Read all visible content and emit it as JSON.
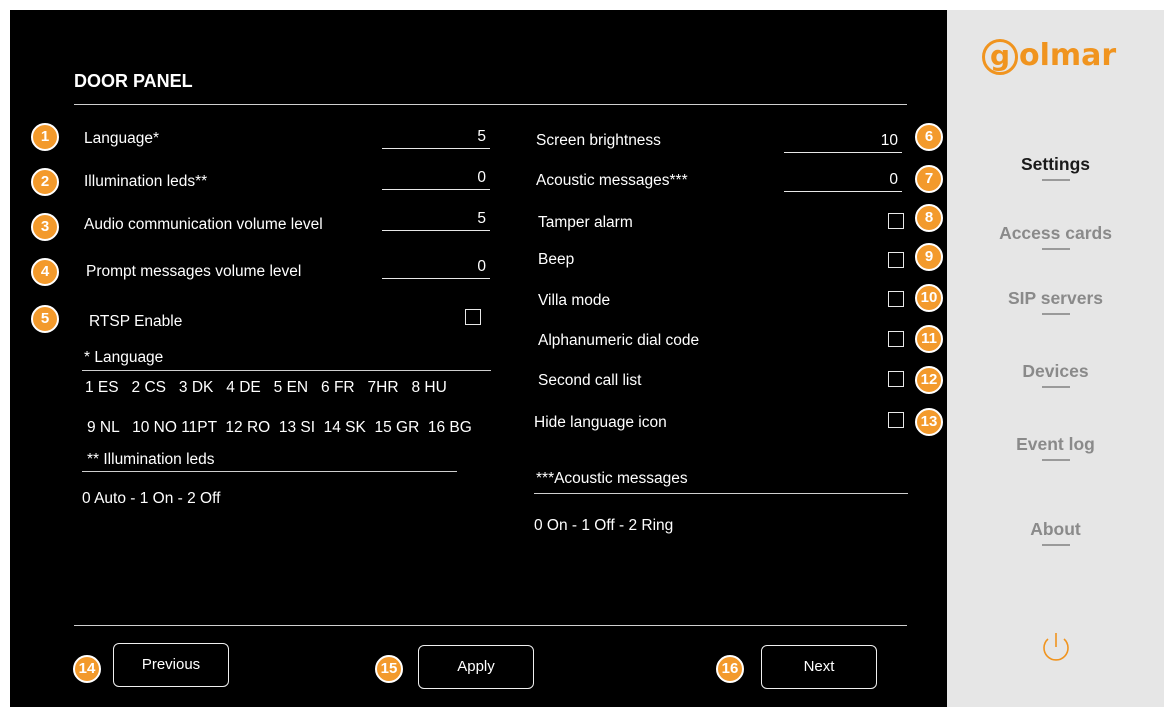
{
  "page": {
    "title": "DOOR PANEL"
  },
  "left_fields": [
    {
      "badge": "1",
      "label": "Language*",
      "value": "5"
    },
    {
      "badge": "2",
      "label": "Illumination leds**",
      "value": "0"
    },
    {
      "badge": "3",
      "label": "Audio communication volume level",
      "value": "5"
    },
    {
      "badge": "4",
      "label": "Prompt messages volume level",
      "value": "0"
    }
  ],
  "rtsp": {
    "badge": "5",
    "label": "RTSP Enable"
  },
  "right_fields": [
    {
      "badge": "6",
      "label": "Screen brightness",
      "value": "10"
    },
    {
      "badge": "7",
      "label": "Acoustic messages***",
      "value": "0"
    }
  ],
  "right_checks": [
    {
      "badge": "8",
      "label": "Tamper alarm"
    },
    {
      "badge": "9",
      "label": "Beep"
    },
    {
      "badge": "10",
      "label": "Villa mode"
    },
    {
      "badge": "11",
      "label": "Alphanumeric dial code"
    },
    {
      "badge": "12",
      "label": "Second call list"
    },
    {
      "badge": "13",
      "label": "Hide language icon"
    }
  ],
  "notes": {
    "language_title": "* Language",
    "language_line1": "1 ES   2 CS   3 DK   4 DE   5 EN   6 FR   7HR   8 HU",
    "language_line2": "9 NL   10 NO 11PT  12 RO  13 SI  14 SK  15 GR  16 BG",
    "leds_title": "** Illumination leds",
    "leds_values": "0 Auto - 1 On - 2 Off",
    "acoustic_title": "***Acoustic messages",
    "acoustic_values": "0 On - 1 Off - 2 Ring"
  },
  "buttons": [
    {
      "badge": "14",
      "label": "Previous"
    },
    {
      "badge": "15",
      "label": "Apply"
    },
    {
      "badge": "16",
      "label": "Next"
    }
  ],
  "sidebar": {
    "logo": "golmar",
    "logo_letter": "g",
    "logo_rest": "olmar",
    "active": "Settings",
    "items": [
      {
        "label": "Settings",
        "active": true
      },
      {
        "label": "Access cards",
        "active": false
      },
      {
        "label": "SIP servers",
        "active": false
      },
      {
        "label": "Devices",
        "active": false
      },
      {
        "label": "Event log",
        "active": false
      },
      {
        "label": "About",
        "active": false
      }
    ],
    "power_icon": "power-icon"
  },
  "colors": {
    "accent": "#f39a2c",
    "panel_bg": "#000000",
    "sidebar_bg": "#e6e6e6",
    "logo": "#f0941f"
  }
}
